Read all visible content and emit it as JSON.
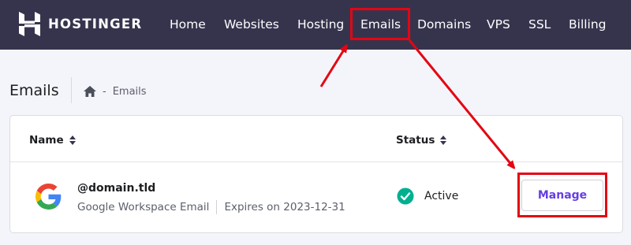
{
  "brand": {
    "name": "HOSTINGER"
  },
  "nav": {
    "items": [
      "Home",
      "Websites",
      "Hosting",
      "Emails",
      "Domains",
      "VPS",
      "SSL",
      "Billing"
    ],
    "highlighted": "Emails"
  },
  "page": {
    "title": "Emails",
    "breadcrumb": {
      "separator": "-",
      "current": "Emails",
      "home_icon": "home-icon"
    }
  },
  "table": {
    "columns": {
      "name": "Name",
      "status": "Status"
    },
    "rows": [
      {
        "provider_icon": "google-icon",
        "domain": "@domain.tld",
        "product": "Google Workspace Email",
        "expiry": "Expires on 2023-12-31",
        "status": "Active",
        "status_icon": "check-circle-icon",
        "action_label": "Manage"
      }
    ]
  },
  "colors": {
    "navbar": "#36344d",
    "accent": "#673de6",
    "status_active": "#00b090",
    "annotation": "#e30613"
  }
}
